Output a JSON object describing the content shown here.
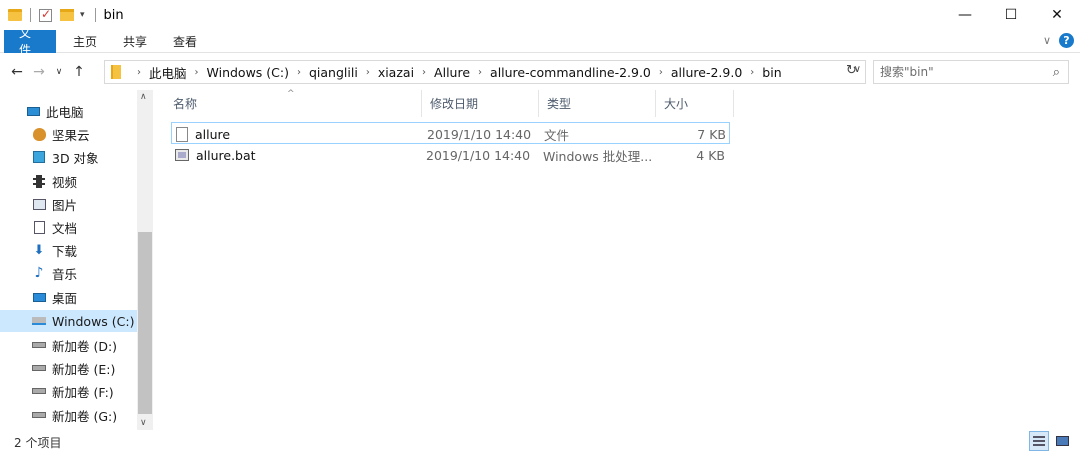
{
  "window": {
    "title": "bin",
    "minimize": "—",
    "maximize": "☐",
    "close": "✕"
  },
  "ribbon": {
    "tabs": [
      "文件",
      "主页",
      "共享",
      "查看"
    ],
    "expand": "∨",
    "help": "?"
  },
  "nav": {
    "back": "←",
    "forward": "→",
    "recent": "∨",
    "up": "↑",
    "breadcrumb": [
      "此电脑",
      "Windows (C:)",
      "qianglili",
      "xiazai",
      "Allure",
      "allure-commandline-2.9.0",
      "allure-2.9.0",
      "bin"
    ],
    "dropdown": "∨",
    "refresh": "↻",
    "search_placeholder": "搜索\"bin\"",
    "search_icon": "⌕"
  },
  "sidebar": {
    "items": [
      {
        "label": "此电脑",
        "icon": "computer-icon"
      },
      {
        "label": "坚果云",
        "icon": "nutstore-icon"
      },
      {
        "label": "3D 对象",
        "icon": "cube-icon"
      },
      {
        "label": "视频",
        "icon": "video-icon"
      },
      {
        "label": "图片",
        "icon": "picture-icon"
      },
      {
        "label": "文档",
        "icon": "document-icon"
      },
      {
        "label": "下载",
        "icon": "download-icon"
      },
      {
        "label": "音乐",
        "icon": "music-icon"
      },
      {
        "label": "桌面",
        "icon": "desktop-icon"
      },
      {
        "label": "Windows (C:)",
        "icon": "windows-drive-icon",
        "selected": true
      },
      {
        "label": "新加卷 (D:)",
        "icon": "drive-icon"
      },
      {
        "label": "新加卷 (E:)",
        "icon": "drive-icon"
      },
      {
        "label": "新加卷 (F:)",
        "icon": "drive-icon"
      },
      {
        "label": "新加卷 (G:)",
        "icon": "drive-icon"
      }
    ],
    "scroll_up": "∧",
    "scroll_down": "∨"
  },
  "filelist": {
    "columns": [
      "名称",
      "修改日期",
      "类型",
      "大小"
    ],
    "sort_caret": "^",
    "rows": [
      {
        "name": "allure",
        "date": "2019/1/10 14:40",
        "type": "文件",
        "size": "7 KB",
        "icon": "file-icon",
        "selected": true
      },
      {
        "name": "allure.bat",
        "date": "2019/1/10 14:40",
        "type": "Windows 批处理...",
        "size": "4 KB",
        "icon": "batch-file-icon",
        "selected": false
      }
    ]
  },
  "status": {
    "count": "2 个项目"
  }
}
